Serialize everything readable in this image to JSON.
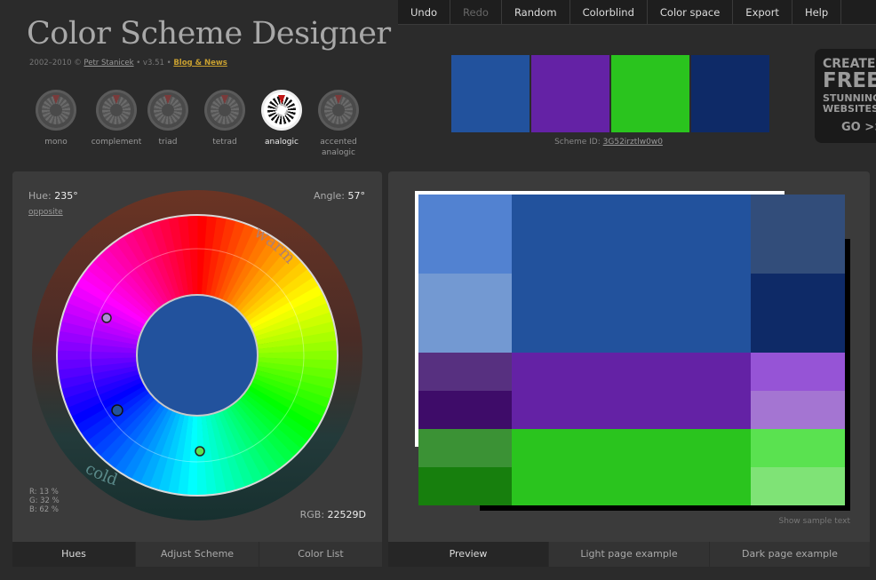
{
  "menu": [
    {
      "label": "Undo",
      "disabled": false
    },
    {
      "label": "Redo",
      "disabled": true
    },
    {
      "label": "Random",
      "disabled": false
    },
    {
      "label": "Colorblind",
      "disabled": false
    },
    {
      "label": "Color space",
      "disabled": false
    },
    {
      "label": "Export",
      "disabled": false
    },
    {
      "label": "Help",
      "disabled": false
    }
  ],
  "app": {
    "title": "Color Scheme Designer",
    "years": "2002–2010 ©",
    "author": "Petr Stanicek",
    "version": "• v3.51 •",
    "blog_link": "Blog & News"
  },
  "scheme_types": [
    {
      "label": "mono",
      "active": false
    },
    {
      "label": "complement",
      "active": false
    },
    {
      "label": "triad",
      "active": false
    },
    {
      "label": "tetrad",
      "active": false
    },
    {
      "label": "analogic",
      "active": true
    },
    {
      "label": "accented analogic",
      "active": false
    }
  ],
  "swatches": [
    "#22529D",
    "#6422A5",
    "#2AC41E",
    "#0E2A67"
  ],
  "scheme_id": {
    "label": "Scheme ID:",
    "value": "3G52irztlw0w0"
  },
  "ad": {
    "line1": "CREATE",
    "line2": "FREE",
    "line3": "STUNNING",
    "line4": "WEBSITES",
    "line5": "GO >>"
  },
  "wheel": {
    "hue_label": "Hue:",
    "hue_value": "235°",
    "opposite": "opposite",
    "angle_label": "Angle:",
    "angle_value": "57°",
    "warm_label": "warm",
    "cold_label": "cold",
    "rgb_label": "RGB:",
    "rgb_value": "22529D",
    "r": "R: 13 %",
    "g": "G: 32 %",
    "b": "B: 62 %",
    "center_color": "#22529D"
  },
  "left_tabs": [
    {
      "label": "Hues",
      "active": true
    },
    {
      "label": "Adjust Scheme",
      "active": false
    },
    {
      "label": "Color List",
      "active": false
    }
  ],
  "right_tabs": [
    {
      "label": "Preview",
      "active": true
    },
    {
      "label": "Light page example",
      "active": false
    },
    {
      "label": "Dark page example",
      "active": false
    }
  ],
  "preview": {
    "sample_text": "Show sample text",
    "rows": [
      {
        "left": [
          "#5282D1",
          "#7399D2"
        ],
        "main": "#22529D",
        "right": [
          "#324D7A",
          "#0E2A67"
        ]
      },
      {
        "left": [
          "#573080",
          "#3E0C69"
        ],
        "main": "#6422A5",
        "right": [
          "#9654D6",
          "#A475D2"
        ]
      },
      {
        "left": [
          "#3B9235",
          "#177F0D"
        ],
        "main": "#2AC41E",
        "right": [
          "#5AE250",
          "#7FE376"
        ]
      }
    ]
  }
}
